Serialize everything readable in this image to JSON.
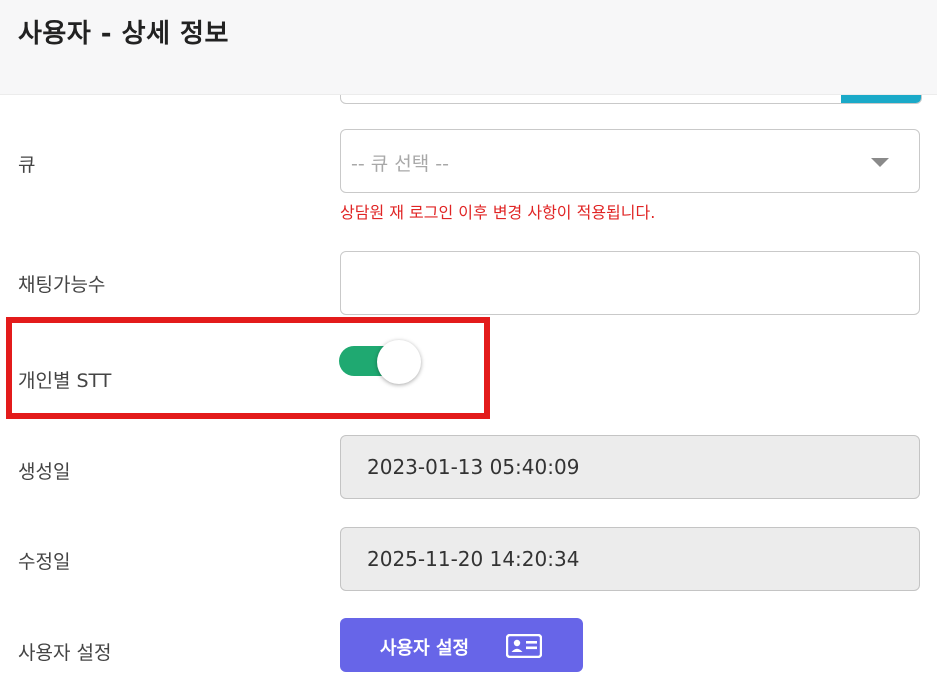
{
  "header": {
    "title": "사용자 - 상세 정보"
  },
  "form": {
    "queue": {
      "label": "큐",
      "placeholder": "-- 큐 선택 --",
      "notice": "상담원 재 로그인 이후 변경 사항이 적용됩니다."
    },
    "chat_capacity": {
      "label": "채팅가능수",
      "value": ""
    },
    "personal_stt": {
      "label": "개인별 STT",
      "enabled": true
    },
    "created": {
      "label": "생성일",
      "value": "2023-01-13 05:40:09"
    },
    "modified": {
      "label": "수정일",
      "value": "2025-11-20 14:20:34"
    },
    "user_settings": {
      "label": "사용자 설정",
      "button_label": "사용자 설정",
      "button_icon": "id-card-icon"
    }
  },
  "colors": {
    "notice": "#e02525",
    "toggle_on": "#1fa971",
    "highlight": "#e31b1b",
    "button": "#6765e8"
  }
}
